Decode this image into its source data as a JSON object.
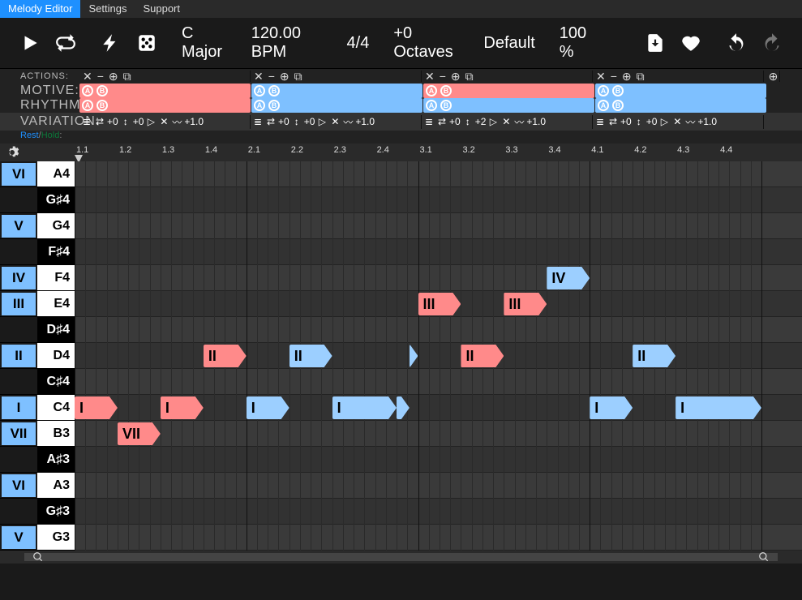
{
  "menu": {
    "items": [
      "Melody Editor",
      "Settings",
      "Support"
    ],
    "active": 0
  },
  "toolbar": {
    "key": "C Major",
    "bpm": "120.00 BPM",
    "timesig": "4/4",
    "octaves": "+0 Octaves",
    "preset": "Default",
    "zoom": "100 %"
  },
  "rowLabels": {
    "actions": "Actions:",
    "motive": "Motive:",
    "rhythm": "Rhythm:",
    "variation": "Variation:"
  },
  "restLabel": "Rest",
  "holdLabel": "Hold",
  "motiveChips": [
    "A",
    "B"
  ],
  "segments": [
    {
      "motive": "red",
      "rhythm": "red",
      "var": [
        "+0",
        "+0",
        "+1.0"
      ]
    },
    {
      "motive": "blue",
      "rhythm": "blue",
      "var": [
        "+0",
        "+0",
        "+1.0"
      ]
    },
    {
      "motive": "red",
      "rhythm": "blue",
      "var": [
        "+0",
        "+2",
        "+1.0"
      ]
    },
    {
      "motive": "blue",
      "rhythm": "blue",
      "var": [
        "+0",
        "+0",
        "+1.0"
      ]
    }
  ],
  "ticks": [
    "1.1",
    "1.2",
    "1.3",
    "1.4",
    "2.1",
    "2.2",
    "2.3",
    "2.4",
    "3.1",
    "3.2",
    "3.3",
    "3.4",
    "4.1",
    "4.2",
    "4.3",
    "4.4"
  ],
  "keys": [
    {
      "deg": "VI",
      "note": "A4",
      "white": true
    },
    {
      "deg": "",
      "note": "G♯4",
      "white": false
    },
    {
      "deg": "V",
      "note": "G4",
      "white": true
    },
    {
      "deg": "",
      "note": "F♯4",
      "white": false
    },
    {
      "deg": "IV",
      "note": "F4",
      "white": true
    },
    {
      "deg": "III",
      "note": "E4",
      "white": true
    },
    {
      "deg": "",
      "note": "D♯4",
      "white": false
    },
    {
      "deg": "II",
      "note": "D4",
      "white": true
    },
    {
      "deg": "",
      "note": "C♯4",
      "white": false
    },
    {
      "deg": "I",
      "note": "C4",
      "white": true
    },
    {
      "deg": "VII",
      "note": "B3",
      "white": true
    },
    {
      "deg": "",
      "note": "A♯3",
      "white": false
    },
    {
      "deg": "VI",
      "note": "A3",
      "white": true
    },
    {
      "deg": "",
      "note": "G♯3",
      "white": false
    },
    {
      "deg": "V",
      "note": "G3",
      "white": true
    }
  ],
  "notes": [
    {
      "row": 4,
      "start": 11,
      "len": 1,
      "label": "IV",
      "color": "blue"
    },
    {
      "row": 5,
      "start": 8,
      "len": 1,
      "label": "III",
      "color": "red"
    },
    {
      "row": 5,
      "start": 10,
      "len": 1,
      "label": "III",
      "color": "red"
    },
    {
      "row": 7,
      "start": 3,
      "len": 1,
      "label": "II",
      "color": "red"
    },
    {
      "row": 7,
      "start": 5,
      "len": 1,
      "label": "II",
      "color": "blue"
    },
    {
      "row": 7,
      "start": 7.8,
      "len": 0.2,
      "label": "",
      "color": "blue"
    },
    {
      "row": 7,
      "start": 9,
      "len": 1,
      "label": "II",
      "color": "red"
    },
    {
      "row": 7,
      "start": 13,
      "len": 1,
      "label": "II",
      "color": "blue"
    },
    {
      "row": 9,
      "start": 0,
      "len": 1,
      "label": "I",
      "color": "red"
    },
    {
      "row": 9,
      "start": 2,
      "len": 1,
      "label": "I",
      "color": "red"
    },
    {
      "row": 9,
      "start": 4,
      "len": 1,
      "label": "I",
      "color": "blue"
    },
    {
      "row": 9,
      "start": 6,
      "len": 1.5,
      "label": "I",
      "color": "blue"
    },
    {
      "row": 9,
      "start": 7.5,
      "len": 0.3,
      "label": "",
      "color": "blue"
    },
    {
      "row": 9,
      "start": 12,
      "len": 1,
      "label": "I",
      "color": "blue"
    },
    {
      "row": 9,
      "start": 14,
      "len": 2,
      "label": "I",
      "color": "blue"
    },
    {
      "row": 10,
      "start": 1,
      "len": 1,
      "label": "VII",
      "color": "red"
    }
  ],
  "colors": {
    "accent": "#1e90ff",
    "red": "#ff8a8a",
    "blue": "#9ccfff"
  }
}
